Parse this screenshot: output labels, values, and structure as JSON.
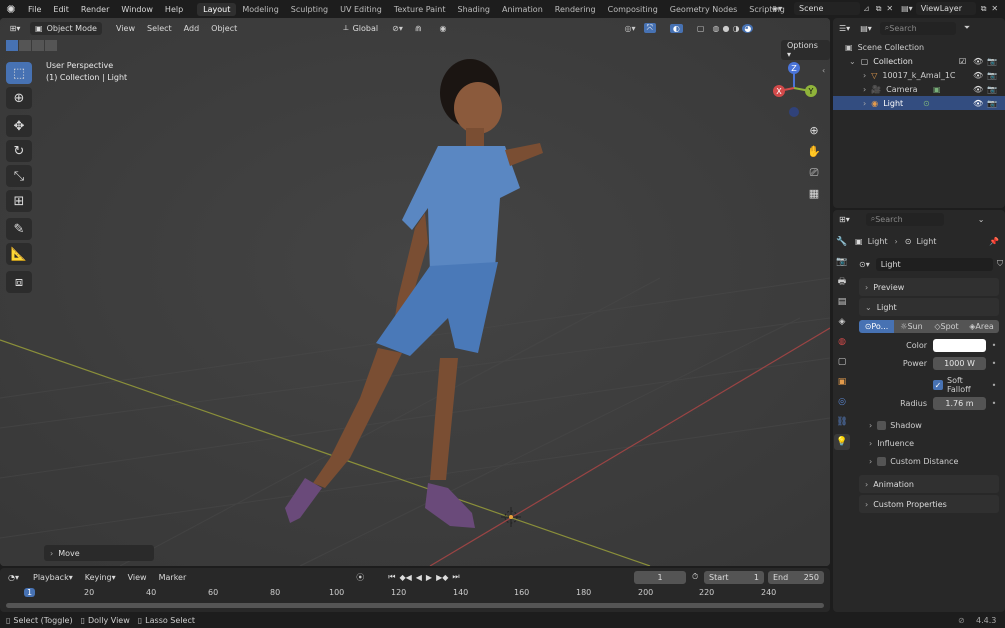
{
  "topbar": {
    "menus": [
      "File",
      "Edit",
      "Render",
      "Window",
      "Help"
    ],
    "workspaces": [
      "Layout",
      "Modeling",
      "Sculpting",
      "UV Editing",
      "Texture Paint",
      "Shading",
      "Animation",
      "Rendering",
      "Compositing",
      "Geometry Nodes",
      "Scripting"
    ],
    "active_workspace": "Layout",
    "add_tab": "+",
    "scene": "Scene",
    "view_layer": "ViewLayer"
  },
  "viewport": {
    "mode": "Object Mode",
    "menus": [
      "View",
      "Select",
      "Add",
      "Object"
    ],
    "transform": "Global",
    "options": "Options",
    "overlay_title": "User Perspective",
    "overlay_sub": "(1) Collection | Light",
    "last_op": "Move",
    "gizmo": {
      "z": "Z",
      "x": "X",
      "y": "Y"
    }
  },
  "outliner": {
    "search_placeholder": "Search",
    "scene_collection": "Scene Collection",
    "collection": "Collection",
    "items": [
      {
        "name": "10017_k_Amal_1C"
      },
      {
        "name": "Camera"
      },
      {
        "name": "Light"
      }
    ]
  },
  "properties": {
    "search_placeholder": "Search",
    "breadcrumb_a": "Light",
    "breadcrumb_b": "Light",
    "datablock": "Light",
    "panels": {
      "preview": "Preview",
      "light": "Light",
      "animation": "Animation",
      "custom": "Custom Properties"
    },
    "light_types": [
      "Po...",
      "Sun",
      "Spot",
      "Area"
    ],
    "color_label": "Color",
    "power_label": "Power",
    "power": "1000 W",
    "soft_falloff": "Soft Falloff",
    "radius_label": "Radius",
    "radius": "1.76 m",
    "subpanels": [
      "Shadow",
      "Influence",
      "Custom Distance"
    ]
  },
  "timeline": {
    "menus": [
      "Playback",
      "Keying",
      "View",
      "Marker"
    ],
    "current_frame": "1",
    "start_label": "Start",
    "start": "1",
    "end_label": "End",
    "end": "250",
    "ticks": [
      "1",
      "20",
      "40",
      "60",
      "80",
      "100",
      "120",
      "140",
      "160",
      "180",
      "200",
      "220",
      "240"
    ]
  },
  "statusbar": {
    "items": [
      "Select (Toggle)",
      "Dolly View",
      "Lasso Select"
    ],
    "version": "4.4.3"
  },
  "colors": {
    "accent": "#4772b3",
    "viewport_bg": "#3e3e3e",
    "panel_bg": "#282828",
    "selected_row": "#334d80"
  }
}
